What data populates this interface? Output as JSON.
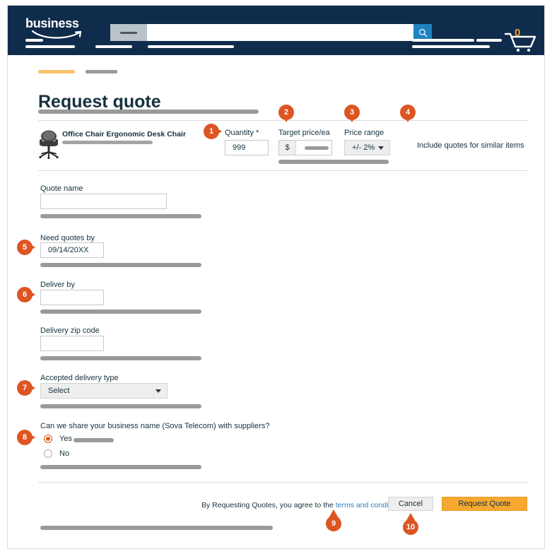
{
  "header": {
    "logo_text": "business",
    "search_placeholder": "",
    "search_icon": "search-icon",
    "category_selector": "",
    "cart_icon": "shopping-cart-icon",
    "cart_count": "0"
  },
  "page": {
    "title": "Request quote"
  },
  "product": {
    "image_alt": "office-chair-thumbnail",
    "name": "Office Chair Ergonomic Desk Chair"
  },
  "quote_row": {
    "quantity_label": "Quantity *",
    "quantity_value": "999",
    "target_price_label": "Target price/ea",
    "target_price_prefix": "$",
    "target_price_value": "",
    "price_range_label": "Price range",
    "price_range_value": "+/- 2%",
    "similar_items_text": "Include quotes for similar items"
  },
  "form": {
    "quote_name_label": "Quote name",
    "quote_name_value": "",
    "need_quotes_by_label": "Need quotes by",
    "need_quotes_by_value": "09/14/20XX",
    "deliver_by_label": "Deliver by",
    "deliver_by_value": "",
    "delivery_zip_label": "Delivery zip code",
    "delivery_zip_value": "",
    "delivery_type_label": "Accepted delivery type",
    "delivery_type_value": "Select",
    "share_name_question": "Can we share your business name (Sova Telecom) with suppliers?",
    "radio_yes": "Yes",
    "radio_no": "No"
  },
  "footer": {
    "agree_prefix": "By Requesting Quotes, you agree to the ",
    "terms_link": "terms and conditions",
    "cancel_label": "Cancel",
    "submit_label": "Request Quote"
  },
  "markers": {
    "m1": "1",
    "m2": "2",
    "m3": "3",
    "m4": "4",
    "m5": "5",
    "m6": "6",
    "m7": "7",
    "m8": "8",
    "m9": "9",
    "m10": "10"
  },
  "colors": {
    "header_bg": "#102c4c",
    "accent_orange": "#f7a831",
    "marker_orange": "#dd5522",
    "link_blue": "#2b7fbd",
    "search_btn_blue": "#1f82c0"
  }
}
